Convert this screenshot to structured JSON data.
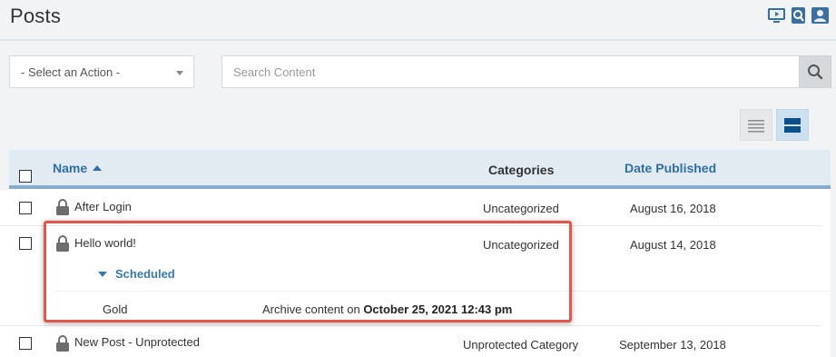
{
  "header": {
    "title": "Posts",
    "icons": [
      "video-tutorial-icon",
      "search-doc-icon",
      "user-profile-icon"
    ]
  },
  "toolbar": {
    "action_select_value": "- Select an Action -",
    "search_placeholder": "Search Content"
  },
  "table": {
    "columns": {
      "name": "Name",
      "categories": "Categories",
      "date_published": "Date Published"
    },
    "rows": [
      {
        "title": "After Login",
        "category": "Uncategorized",
        "date": "August 16, 2018"
      },
      {
        "title": "Hello world!",
        "category": "Uncategorized",
        "date": "August 14, 2018"
      },
      {
        "title": "New Post - Unprotected",
        "category": "Unprotected Category",
        "date": "September 13, 2018"
      }
    ],
    "scheduled": {
      "label": "Scheduled",
      "level": "Gold",
      "archive_prefix": "Archive content on",
      "archive_datetime": "October 25, 2021 12:43 pm"
    }
  },
  "colors": {
    "accent": "#2f6ea8",
    "highlight": "#e2574c",
    "header_bg": "#e2eaf2"
  }
}
